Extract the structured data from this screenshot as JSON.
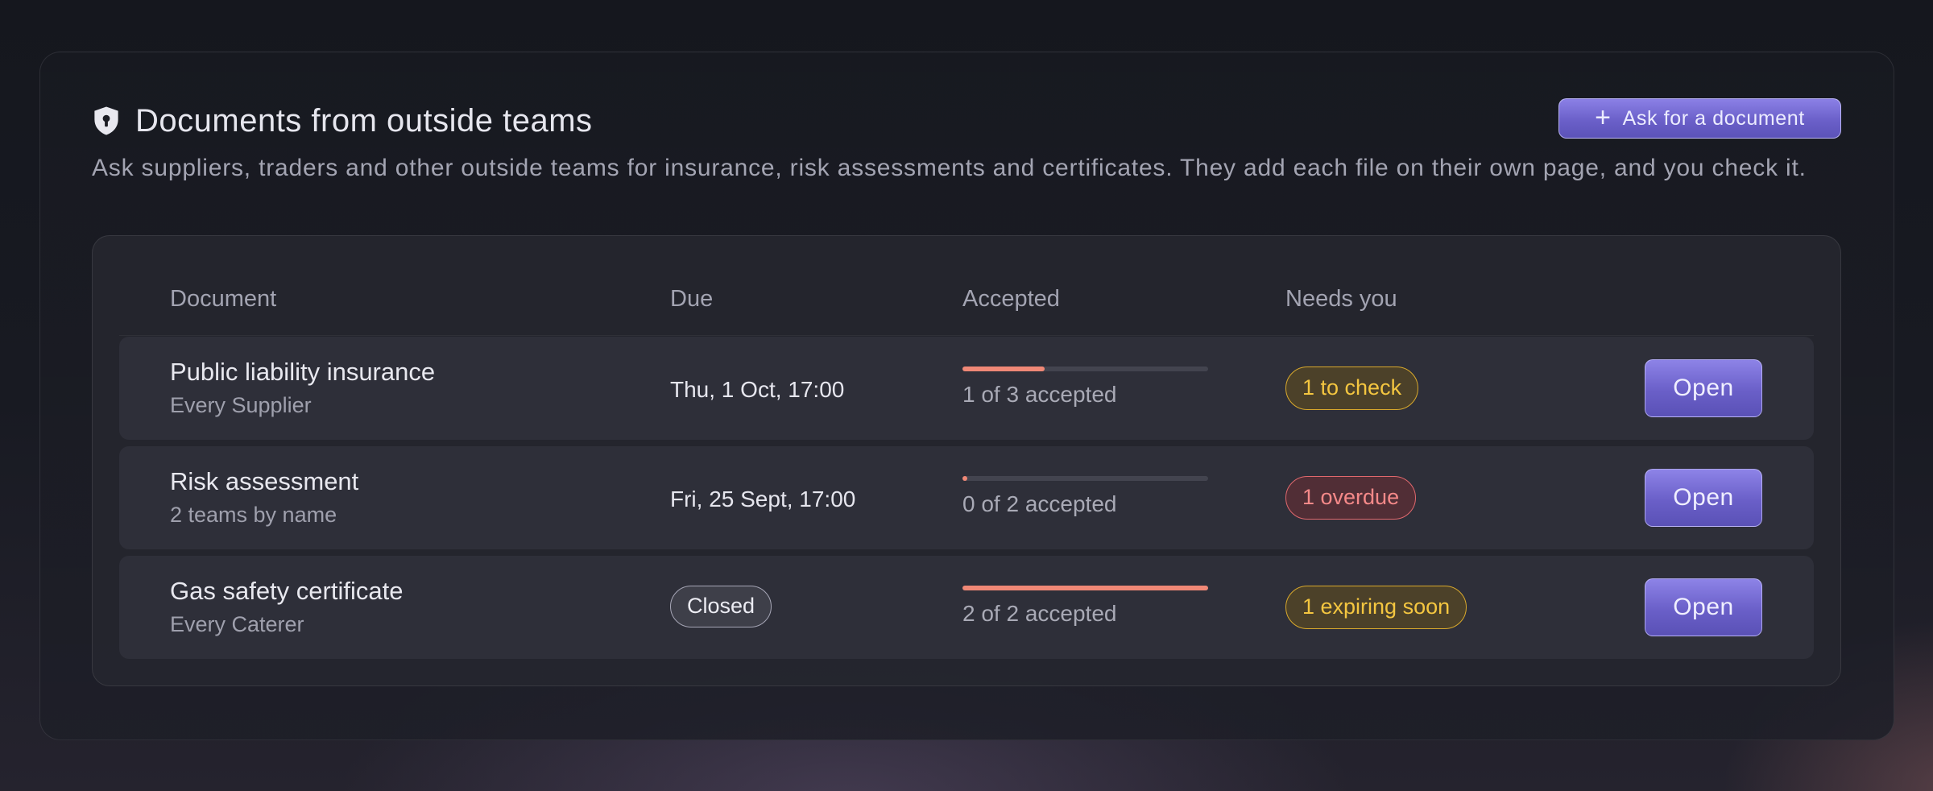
{
  "panel": {
    "title": "Documents from outside teams",
    "title_icon": "shield-lock-icon",
    "description": "Ask suppliers, traders and other outside teams for insurance, risk assessments and certificates. They add each file on their own page, and you check it.",
    "ask_button": {
      "icon": "plus-icon",
      "label": "Ask for a document"
    }
  },
  "table": {
    "columns": [
      "Document",
      "Due",
      "Accepted",
      "Needs you"
    ],
    "rows": [
      {
        "name": "Public liability insurance",
        "audience": "Every Supplier",
        "due": "Thu, 1 Oct, 17:00",
        "accepted_fraction": 0.333,
        "accepted_text": "1 of 3 accepted",
        "needs": "1 to check",
        "needs_tone": "yellow",
        "action": "Open"
      },
      {
        "name": "Risk assessment",
        "audience": "2 teams by name",
        "due": "Fri, 25 Sept, 17:00",
        "accepted_fraction": 0.0,
        "accepted_text": "0 of 2 accepted",
        "needs": "1 overdue",
        "needs_tone": "red",
        "action": "Open"
      },
      {
        "name": "Gas safety certificate",
        "audience": "Every Caterer",
        "due_chip": "Closed",
        "accepted_fraction": 1.0,
        "accepted_text": "2 of 2 accepted",
        "needs": "1 expiring soon",
        "needs_tone": "yellow",
        "action": "Open"
      }
    ]
  },
  "colors": {
    "accent": "#6b60c9",
    "progress": "#f08876",
    "badge_yellow": "#f4c640",
    "badge_red": "#f58989"
  }
}
